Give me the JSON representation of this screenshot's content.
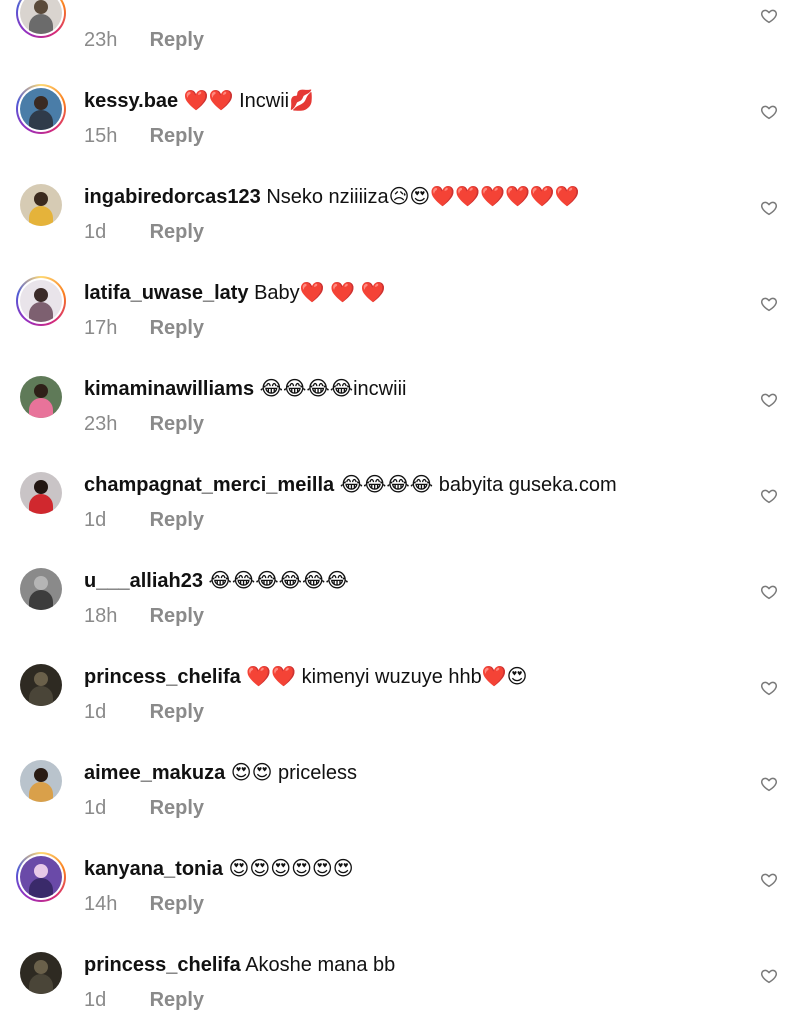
{
  "ui": {
    "reply_label": "Reply",
    "like_icon": "heart-outline-icon"
  },
  "comments": [
    {
      "username": "",
      "text": "",
      "time": "23h",
      "avatar": {
        "ring": true,
        "bg": "#d9d4cf",
        "fig": "#6b6b6b",
        "head": "#5a4a3a"
      }
    },
    {
      "username": "kessy.bae",
      "text": "❤️❤️ Incwii💋",
      "time": "15h",
      "avatar": {
        "ring": true,
        "bg": "#4a7da8",
        "fig": "#2f3b4a",
        "head": "#3a2a22"
      }
    },
    {
      "username": "ingabiredorcas123",
      "text": "Nseko nziiiiza😥😍❤️❤️❤️❤️❤️❤️",
      "time": "1d",
      "avatar": {
        "ring": false,
        "bg": "#d6cbb4",
        "fig": "#e5b33a",
        "head": "#3b2a1e"
      }
    },
    {
      "username": "latifa_uwase_laty",
      "text": "Baby❤️ ❤️ ❤️",
      "time": "17h",
      "avatar": {
        "ring": true,
        "bg": "#e9e4ea",
        "fig": "#7d6070",
        "head": "#3a2a28"
      }
    },
    {
      "username": "kimaminawilliams",
      "text": "😂😂😂😂incwiii",
      "time": "23h",
      "avatar": {
        "ring": false,
        "bg": "#5f7a58",
        "fig": "#e8739a",
        "head": "#2e2018"
      }
    },
    {
      "username": "champagnat_merci_meilla",
      "text": "😂😂😂😂 babyita guseka.com",
      "time": "1d",
      "avatar": {
        "ring": false,
        "bg": "#c9c4c6",
        "fig": "#d0282e",
        "head": "#221612"
      }
    },
    {
      "username": "u___alliah23",
      "text": "😂😂😂😂😂😂",
      "time": "18h",
      "avatar": {
        "ring": false,
        "bg": "#8a8a8a",
        "fig": "#3d3d3d",
        "head": "#b5b5b5"
      }
    },
    {
      "username": "princess_chelifa",
      "text": "❤️❤️ kimenyi wuzuye hhb❤️😍",
      "time": "1d",
      "avatar": {
        "ring": false,
        "bg": "#2e2a22",
        "fig": "#4a4538",
        "head": "#6a604a"
      }
    },
    {
      "username": "aimee_makuza",
      "text": "😍😍 priceless",
      "time": "1d",
      "avatar": {
        "ring": false,
        "bg": "#b9c3cc",
        "fig": "#d9a04a",
        "head": "#2a1c14"
      }
    },
    {
      "username": "kanyana_tonia",
      "text": "😍😍😍😍😍😍",
      "time": "14h",
      "avatar": {
        "ring": true,
        "bg": "#6a4aa8",
        "fig": "#3a2a6a",
        "head": "#e7c9e8"
      }
    },
    {
      "username": "princess_chelifa",
      "text": "Akoshe mana bb",
      "time": "1d",
      "avatar": {
        "ring": false,
        "bg": "#2e2a22",
        "fig": "#4a4538",
        "head": "#6a604a"
      }
    }
  ]
}
